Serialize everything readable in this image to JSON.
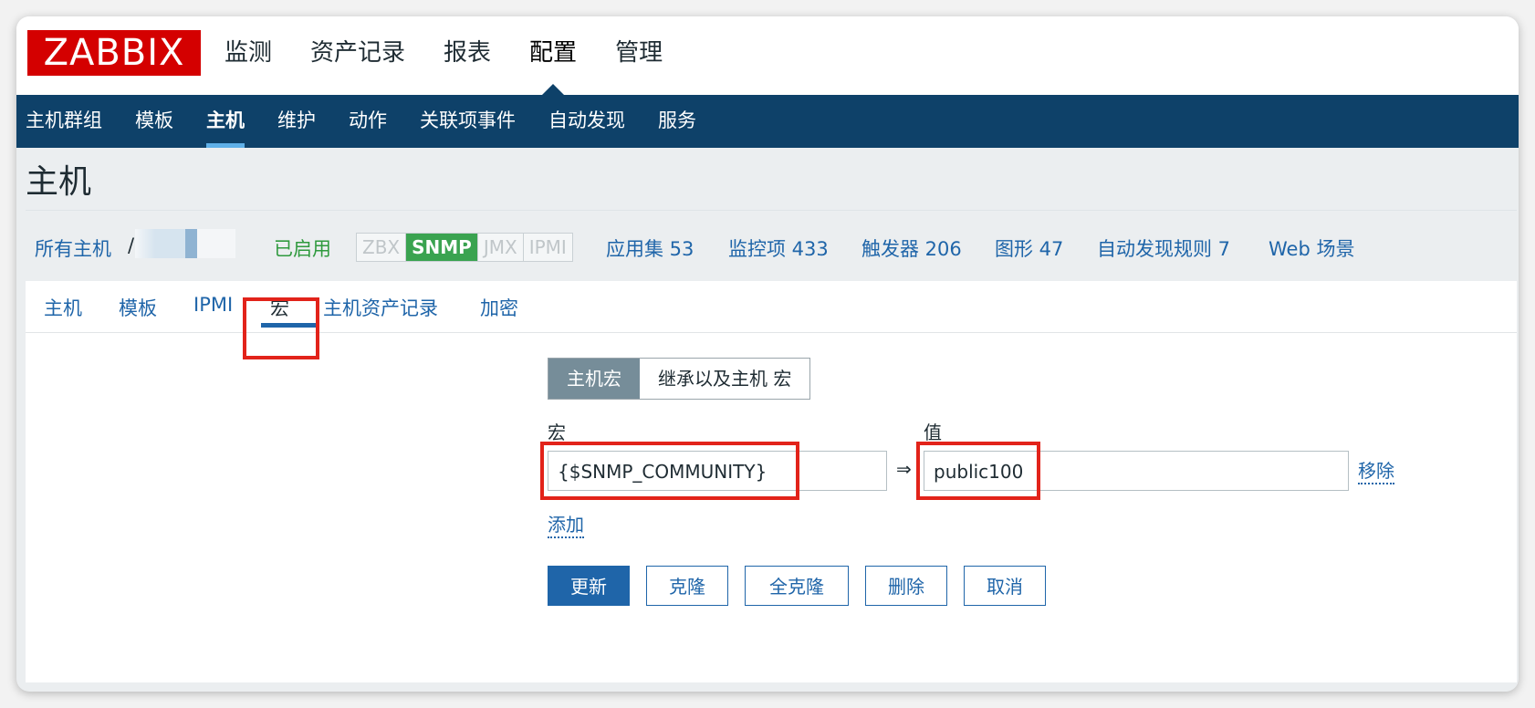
{
  "logo": "ZABBIX",
  "main_nav": [
    "监测",
    "资产记录",
    "报表",
    "配置",
    "管理"
  ],
  "main_nav_active": 3,
  "sub_nav": [
    "主机群组",
    "模板",
    "主机",
    "维护",
    "动作",
    "关联项事件",
    "自动发现",
    "服务"
  ],
  "sub_nav_active": 2,
  "page_title": "主机",
  "host_bar": {
    "all_hosts": "所有主机",
    "separator": "/",
    "status": "已启用",
    "availability": [
      "ZBX",
      "SNMP",
      "JMX",
      "IPMI"
    ],
    "availability_active": "SNMP",
    "links": [
      "应用集 53",
      "监控项 433",
      "触发器 206",
      "图形 47",
      "自动发现规则 7",
      "Web 场景"
    ]
  },
  "tabs": [
    "主机",
    "模板",
    "IPMI",
    "宏",
    "主机资产记录",
    "加密"
  ],
  "tabs_active": 3,
  "macros": {
    "toggle": [
      "主机宏",
      "继承以及主机 宏"
    ],
    "toggle_selected": 0,
    "macro_label": "宏",
    "value_label": "值",
    "macro_value": "{$SNMP_COMMUNITY}",
    "arrow": "⇒",
    "value_value": "public100",
    "remove": "移除",
    "add": "添加"
  },
  "buttons": [
    "更新",
    "克隆",
    "全克隆",
    "删除",
    "取消"
  ],
  "colors": {
    "logo_red": "#d40000",
    "nav_blue": "#0e4169",
    "link_blue": "#1f65a9",
    "enabled_green": "#2f9a3e",
    "snmp_green": "#3aa350",
    "highlight_red": "#e2231a"
  }
}
